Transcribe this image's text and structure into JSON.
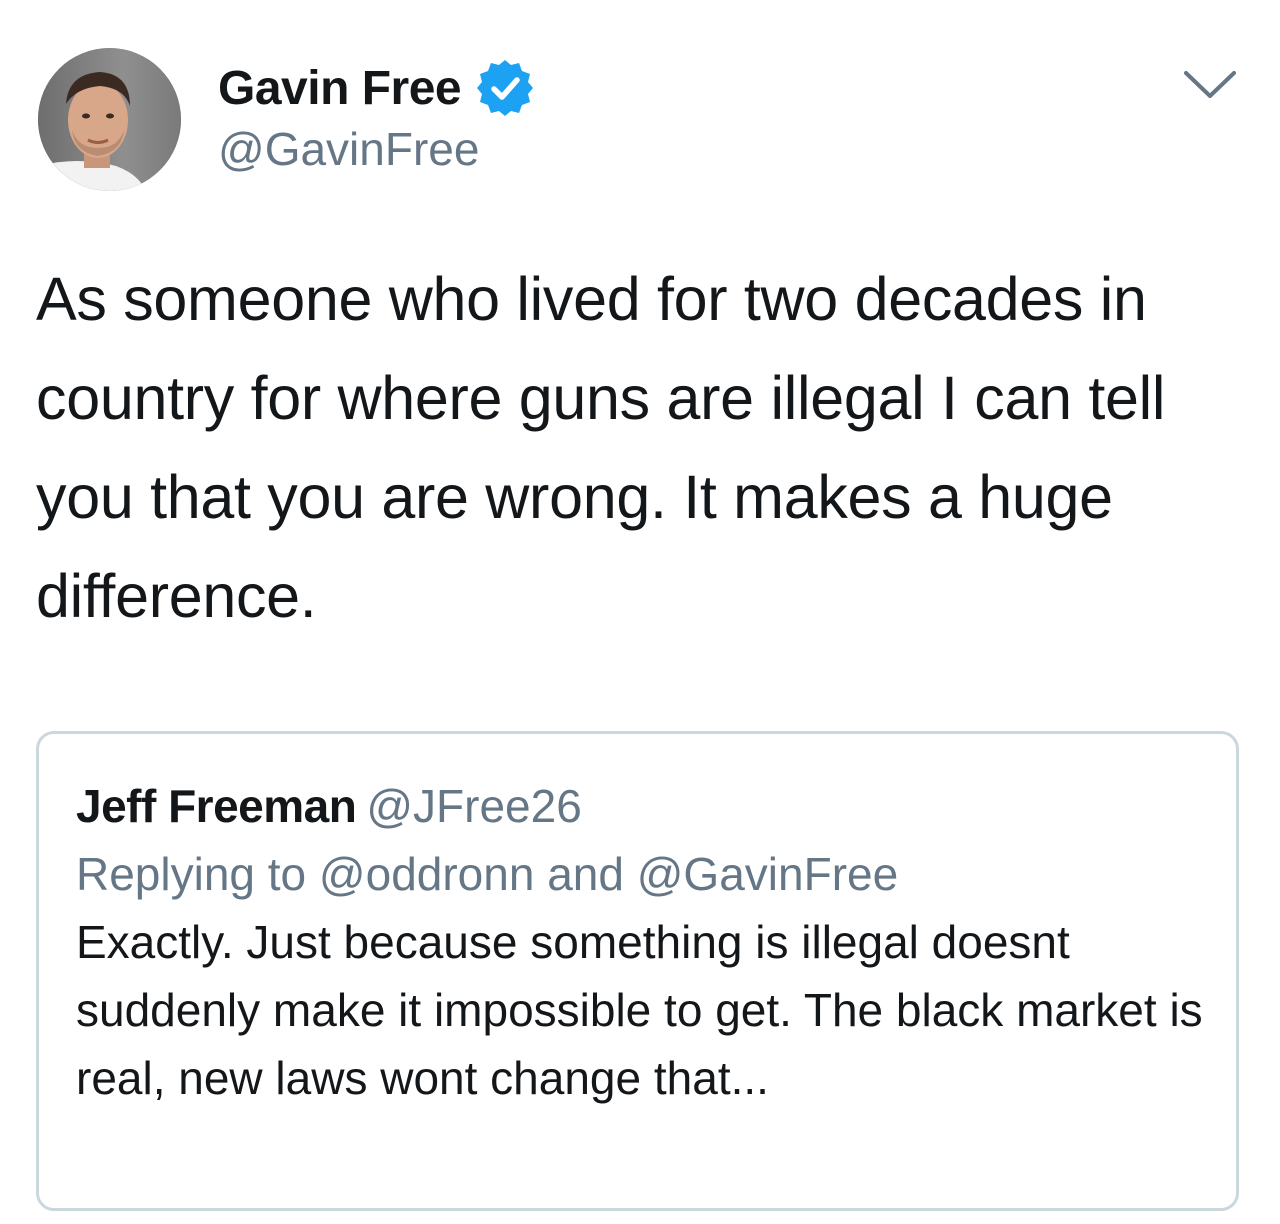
{
  "author": {
    "display_name": "Gavin Free",
    "handle": "@GavinFree",
    "verified": true,
    "avatar": "profile-photo"
  },
  "tweet": {
    "text": "As someone who lived for two decades in country for where guns are illegal I can tell you that you are wrong. It makes a huge difference."
  },
  "quoted_tweet": {
    "display_name": "Jeff Freeman",
    "handle": "@JFree26",
    "reply_line": "Replying to @oddronn and @GavinFree",
    "text": "Exactly. Just because something is illegal doesnt suddenly make it impossible to get. The black market is real, new laws wont change that..."
  },
  "icons": {
    "verified": "verified-badge-icon",
    "menu": "chevron-down-icon"
  },
  "colors": {
    "text_primary": "#14171a",
    "text_secondary": "#657786",
    "verified_blue": "#1da1f2",
    "card_border": "#ccd6dd"
  }
}
